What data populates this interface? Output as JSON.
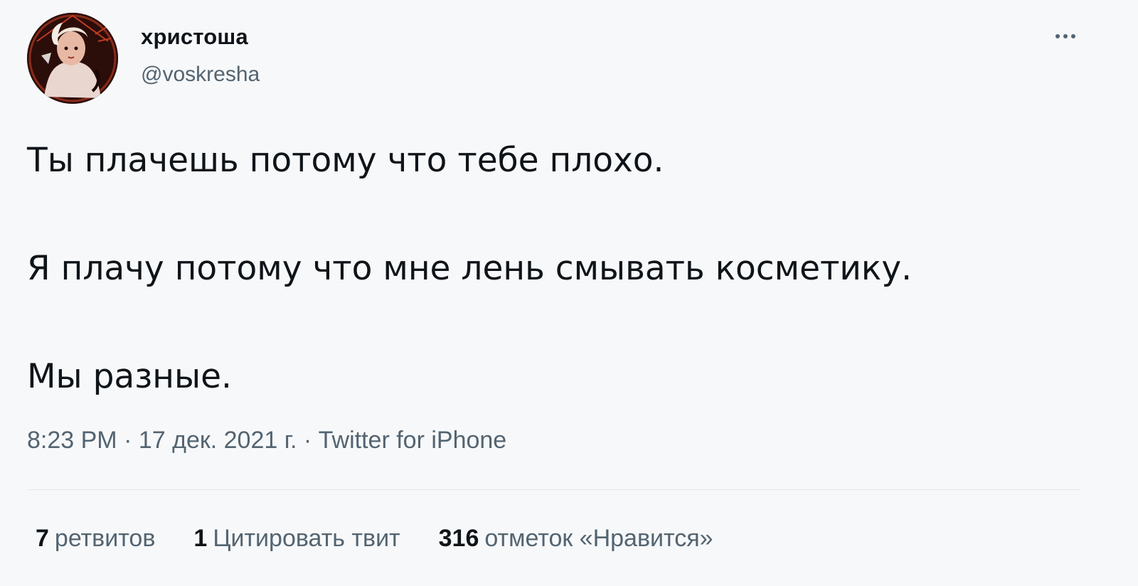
{
  "author": {
    "display_name": "христоша",
    "handle": "@voskresha"
  },
  "tweet": {
    "paragraphs": [
      "Ты плачешь потому что тебе плохо.",
      "Я плачу потому что мне лень смывать косметику.",
      "Мы разные."
    ],
    "time": "8:23 PM",
    "date": "17 дек. 2021 г.",
    "separator": "·",
    "source": "Twitter for iPhone"
  },
  "stats": {
    "retweets": {
      "count": "7",
      "label": "ретвитов"
    },
    "quotes": {
      "count": "1",
      "label": "Цитировать твит"
    },
    "likes": {
      "count": "316",
      "label": "отметок «Нравится»"
    }
  },
  "icons": {
    "more": "more-horizontal-icon",
    "avatar": "user-avatar"
  },
  "colors": {
    "text": "#0f1419",
    "secondary": "#536471",
    "background": "#f7f8f9",
    "divider": "#e4e8eb"
  }
}
